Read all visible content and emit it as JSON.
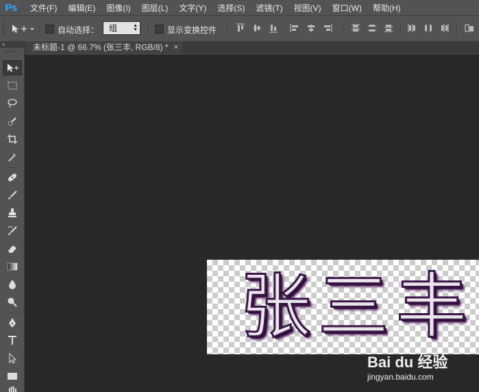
{
  "app": {
    "logo": "Ps"
  },
  "menu": [
    "文件(F)",
    "编辑(E)",
    "图像(I)",
    "图层(L)",
    "文字(Y)",
    "选择(S)",
    "滤镜(T)",
    "视图(V)",
    "窗口(W)",
    "帮助(H)"
  ],
  "options": {
    "auto_select_label": "自动选择：",
    "auto_select_value": "组",
    "show_transform_label": "显示变换控件"
  },
  "document": {
    "tab_title": "未标题-1 @ 66.7% (张三丰, RGB/8) *",
    "close_glyph": "×",
    "canvas_text": "张三丰"
  },
  "toolbox": {
    "header": "»",
    "tools": [
      "move-tool",
      "marquee-tool",
      "lasso-tool",
      "quick-selection-tool",
      "crop-tool",
      "eyedropper-tool",
      "healing-brush-tool",
      "brush-tool",
      "clone-stamp-tool",
      "history-brush-tool",
      "eraser-tool",
      "gradient-tool",
      "blur-tool",
      "dodge-tool",
      "pen-tool",
      "type-tool",
      "path-selection-tool",
      "rectangle-tool"
    ]
  },
  "watermark": {
    "logo": "Bai du 经验",
    "url": "jingyan.baidu.com"
  },
  "colors": {
    "menubar": "#535353",
    "workspace": "#282828",
    "canvas_text_stroke": "#3a1545",
    "ps_logo": "#31a8ff"
  }
}
